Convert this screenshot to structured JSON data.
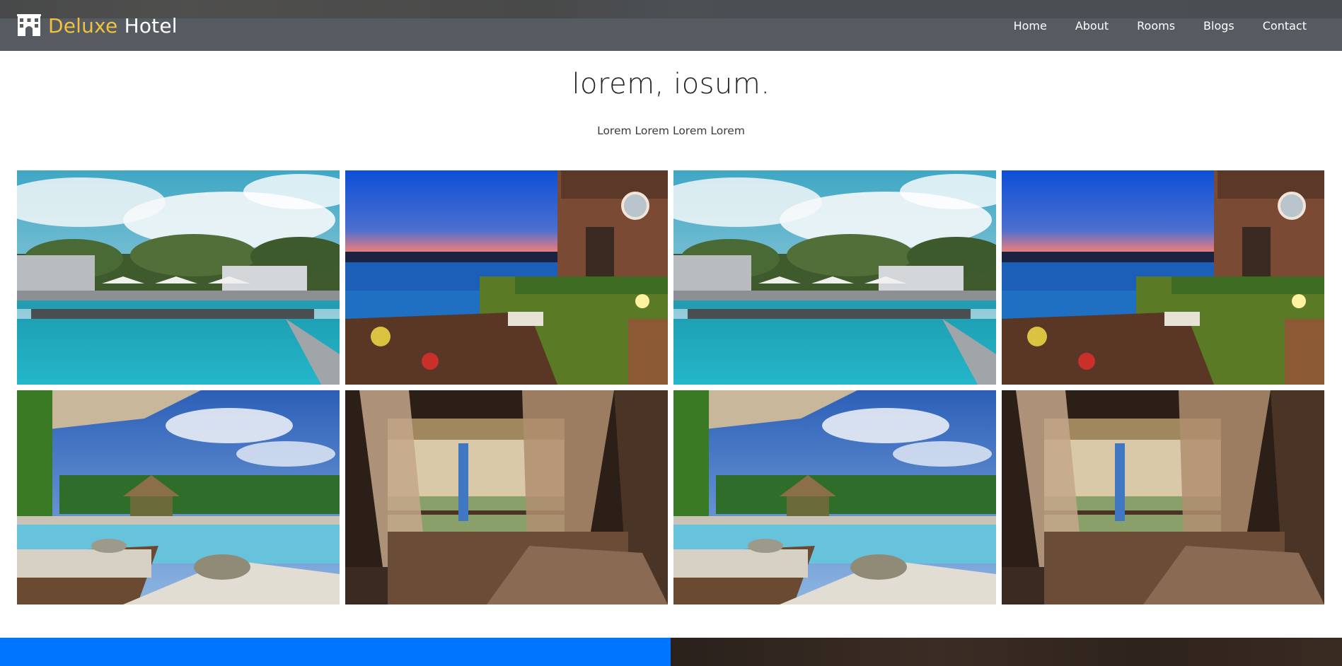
{
  "brand": {
    "first": "Deluxe",
    "second": "Hotel",
    "logo_icon": "hotel-building-icon",
    "accent_color": "#f2c23c"
  },
  "nav": {
    "items": [
      {
        "label": "Home"
      },
      {
        "label": "About"
      },
      {
        "label": "Rooms"
      },
      {
        "label": "Blogs"
      },
      {
        "label": "Contact"
      }
    ]
  },
  "section": {
    "title": "lorem, iosum.",
    "subtitle": "Lorem Lorem Lorem Lorem"
  },
  "gallery": {
    "photos": [
      {
        "subject": "pool-day"
      },
      {
        "subject": "terrace-sunset"
      },
      {
        "subject": "pool-day"
      },
      {
        "subject": "terrace-sunset"
      },
      {
        "subject": "tropical-pool"
      },
      {
        "subject": "bedroom-canopy"
      },
      {
        "subject": "tropical-pool"
      },
      {
        "subject": "bedroom-canopy"
      }
    ]
  },
  "colors": {
    "navbar": "#565b61",
    "bottom_left": "#0075ff"
  }
}
